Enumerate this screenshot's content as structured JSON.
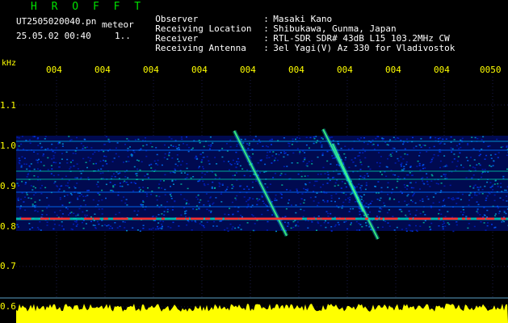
{
  "header": {
    "app_title": "H R O F F T",
    "file_name": "UT2505020040.pn",
    "file_tag": "meteor",
    "date_time": "25.05.02 00:40",
    "frame_no": "1.."
  },
  "station": [
    {
      "key": "Observer",
      "sep": ":",
      "value": "Masaki Kano"
    },
    {
      "key": "Receiving Location",
      "sep": ":",
      "value": "Shibukawa, Gunma, Japan"
    },
    {
      "key": "Receiver",
      "sep": ":",
      "value": "RTL-SDR SDR# 43dB L15 103.2MHz CW"
    },
    {
      "key": "Receiving Antenna",
      "sep": ":",
      "value": "3el Yagi(V) Az 330 for Vladivostok"
    }
  ],
  "axis": {
    "unit": "kHz",
    "x_ticks": [
      "004",
      "004",
      "004",
      "004",
      "004",
      "004",
      "004",
      "004",
      "004",
      "0050"
    ],
    "y_ticks": [
      "1.1",
      "1.0",
      "0.9",
      "0.8",
      "0.7",
      "0.6"
    ]
  },
  "colors": {
    "background": "#000000",
    "label": "#ffff00",
    "title": "#00e000",
    "signal_strong": "#ff3030",
    "signal_mid": "#00e0c0",
    "noise": "#0040ff",
    "level_bar": "#ffff00"
  }
}
